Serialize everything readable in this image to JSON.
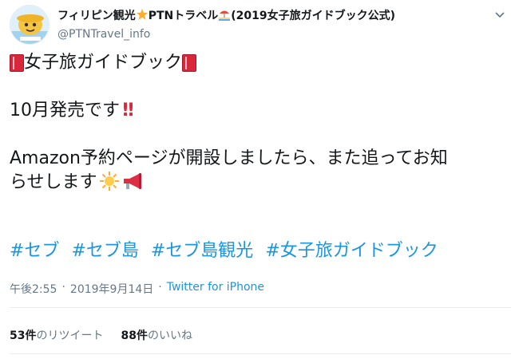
{
  "tweet": {
    "author": {
      "name_part1": "フィリピン観光",
      "name_part2": "PTNトラベル",
      "name_part3": "(2019女子旅ガイドブック公式)",
      "handle": "@PTNTravel_info"
    },
    "lines": {
      "title": "女子旅ガイドブック",
      "line2": "10月発売です",
      "line2_emoji": "!!",
      "line3a": "Amazon予約ページが開設しましたら、また追ってお知",
      "line3b": "らせします"
    },
    "hashtags": [
      "#セブ",
      "#セブ島",
      "#セブ島観光",
      "#女子旅ガイドブック"
    ],
    "meta": {
      "time": "午後2:55",
      "separator1": "·",
      "date": "2019年9月14日",
      "separator2": "·",
      "source": "Twitter for iPhone"
    },
    "stats": {
      "retweets_count": "53件",
      "retweets_label": "のリツイート",
      "likes_count": "88件",
      "likes_label": "のいいね"
    }
  },
  "icons": [
    "star-icon",
    "beach-icon",
    "book-icon",
    "double-exclamation-icon",
    "sun-icon",
    "megaphone-icon",
    "chevron-down-icon"
  ],
  "colors": {
    "link": "#1b95e0",
    "secondary": "#657786",
    "text": "#14171a",
    "accent_red": "#d8263a"
  }
}
